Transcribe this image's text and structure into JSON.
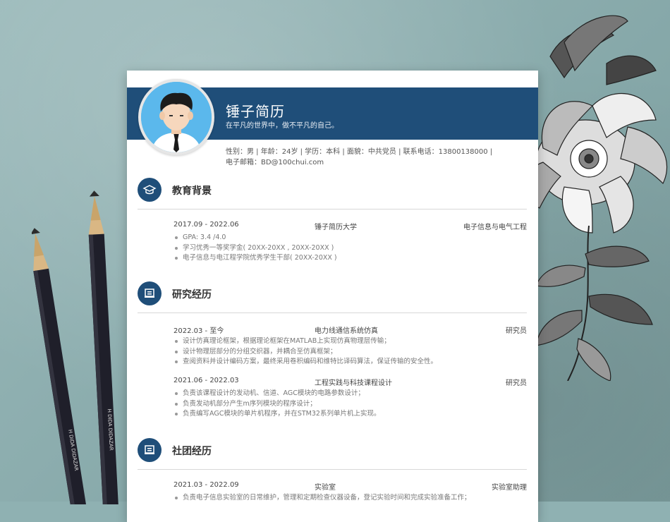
{
  "header": {
    "name": "锤子简历",
    "motto": "在平凡的世界中，做不平凡的自己。",
    "info_line1": "性别：男 | 年龄：24岁 | 学历：本科 | 面貌：中共党员 | 联系电话：13800138000 |",
    "info_line2": "电子邮箱：BD@100chui.com"
  },
  "sections": {
    "education": {
      "title": "教育背景",
      "entries": [
        {
          "date": "2017.09 - 2022.06",
          "org": "锤子简历大学",
          "role": "电子信息与电气工程",
          "bullets": [
            "GPA: 3.4 /4.0",
            "学习优秀一等奖学金( 20XX-20XX , 20XX-20XX )",
            "电子信息与电江程学院优秀学生干部( 20XX-20XX )"
          ]
        }
      ]
    },
    "research": {
      "title": "研究经历",
      "entries": [
        {
          "date": "2022.03 - 至今",
          "org": "电力线通信系统仿真",
          "role": "研究员",
          "bullets": [
            "设计仿真理论框架，根据理论框架在MATLAB上实现仿真物理层传输；",
            "设计物理层部分的分组交织器，并耦合至仿真框架；",
            "查阅资料并设计编码方案，最终采用卷积编码和维特比译码算法，保证传输的安全性。"
          ]
        },
        {
          "date": "2021.06 - 2022.03",
          "org": "工程实践与科技课程设计",
          "role": "研究员",
          "bullets": [
            "负责该课程设计的发动机、信道、AGC模块的电路参数设计；",
            "负责发动机部分产生m序列模块的程序设计；",
            "负责编写AGC模块的单片机程序，并在STM32系列单片机上实现。"
          ]
        }
      ]
    },
    "club": {
      "title": "社团经历",
      "entries": [
        {
          "date": "2021.03 - 2022.09",
          "org": "实验室",
          "role": "实验室助理",
          "bullets": [
            "负责电子信息实验室的日常维护，管理和定期检查仪器设备，登记实验时间和完成实验准备工作；"
          ]
        }
      ]
    }
  },
  "icons": {
    "education": "graduation-cap-icon",
    "research": "certificate-icon",
    "club": "certificate-icon",
    "pencil_brand": "H  DIDA  DIDAZAR"
  },
  "colors": {
    "banner": "#1f4e79",
    "avatar_bg": "#5bb8ec"
  }
}
